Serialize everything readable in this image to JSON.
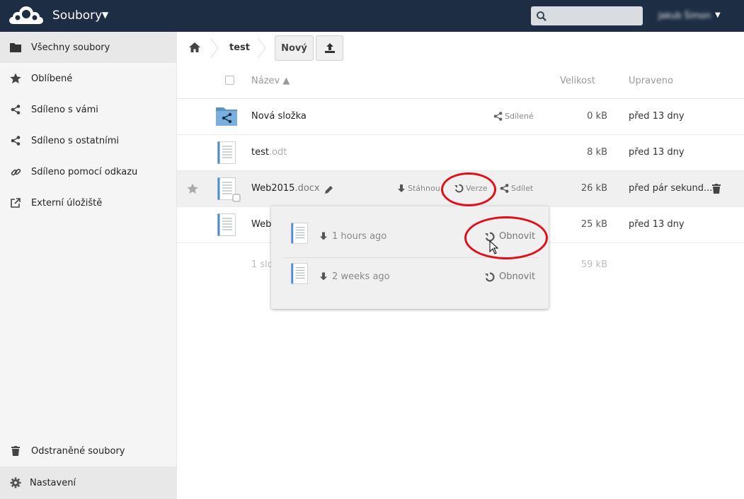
{
  "header": {
    "app_title": "Soubory",
    "search_placeholder": "",
    "user_name": "Jakub Šimon"
  },
  "sidebar": {
    "items": [
      {
        "label": "Všechny soubory",
        "icon": "folder-icon",
        "active": true
      },
      {
        "label": "Oblíbené",
        "icon": "star-icon"
      },
      {
        "label": "Sdíleno s vámi",
        "icon": "share-icon"
      },
      {
        "label": "Sdíleno s ostatními",
        "icon": "share-icon"
      },
      {
        "label": "Sdíleno pomocí odkazu",
        "icon": "link-icon"
      },
      {
        "label": "Externí úložiště",
        "icon": "external-icon"
      }
    ],
    "trash_label": "Odstraněné soubory",
    "settings_label": "Nastavení"
  },
  "controls": {
    "breadcrumb": "test",
    "new_label": "Nový"
  },
  "table": {
    "col_name": "Název ▲",
    "col_size": "Velikost",
    "col_modified": "Upraveno"
  },
  "files": [
    {
      "name": "Nová složka",
      "ext": "",
      "type": "shared-folder",
      "size": "0 kB",
      "modified": "před 13 dny",
      "share_label": "Sdílené"
    },
    {
      "name": "test",
      "ext": ".odt",
      "type": "document",
      "size": "8 kB",
      "modified": "před 13 dny"
    },
    {
      "name": "Web2015",
      "ext": ".docx",
      "type": "document",
      "size": "26 kB",
      "modified": "před pár sekund...",
      "download_label": "Stáhnou",
      "versions_label": "Verze",
      "share_label": "Sdílet"
    },
    {
      "name": "Web",
      "ext": "",
      "type": "document",
      "size": "25 kB",
      "modified": "před 13 dny"
    }
  ],
  "summary": {
    "count": "1 slo",
    "size": "59 kB"
  },
  "versions": [
    {
      "time": "1 hours ago",
      "restore_label": "Obnovit"
    },
    {
      "time": "2 weeks ago",
      "restore_label": "Obnovit"
    }
  ],
  "colors": {
    "header_bg": "#1d2d44",
    "annotation": "#e0101a"
  }
}
